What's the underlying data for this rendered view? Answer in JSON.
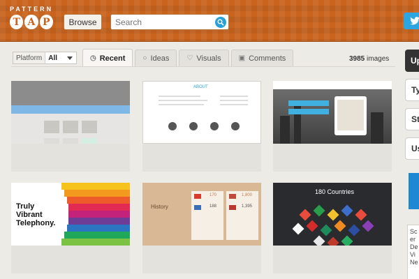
{
  "header": {
    "logo_word": "PATTERN",
    "logo_letters": [
      "T",
      "A",
      "P"
    ],
    "browse_label": "Browse",
    "search_placeholder": "Search"
  },
  "filters": {
    "platform_label": "Platform",
    "platform_value": "All",
    "tabs": [
      {
        "label": "Recent",
        "icon": "clock-icon",
        "active": true
      },
      {
        "label": "Ideas",
        "icon": "lightbulb-icon",
        "active": false
      },
      {
        "label": "Visuals",
        "icon": "heart-icon",
        "active": false
      },
      {
        "label": "Comments",
        "icon": "comment-icon",
        "active": false
      }
    ],
    "count_number": "3985",
    "count_suffix": "images"
  },
  "sidebar": {
    "items": [
      "Up",
      "Ty",
      "St",
      "Us"
    ],
    "card_text": "Sc er De Vi Ne"
  },
  "thumbnails": {
    "card4_text": "Truly Vibrant Telephony.",
    "card5_text": "History",
    "card5_values": [
      "170",
      "1,800",
      "188",
      "1,395"
    ],
    "card6_text": "180 Countries",
    "card2_text": "ABOUT"
  },
  "colors": {
    "header_orange": "#c9641e",
    "accent_blue": "#28a0d8",
    "twitter_blue": "#2ba6e0"
  }
}
